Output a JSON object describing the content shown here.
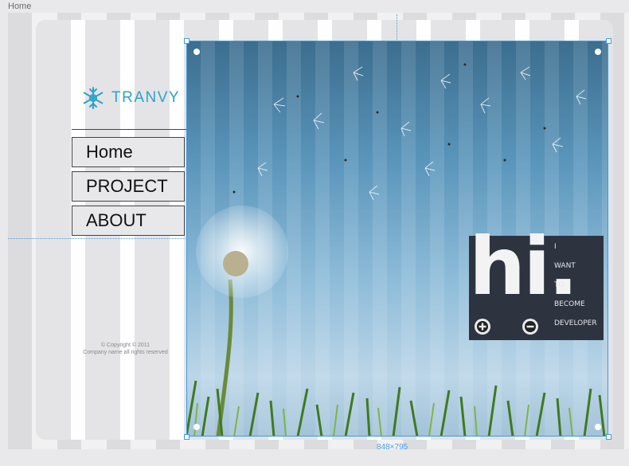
{
  "tab": {
    "label": "Home"
  },
  "brand": {
    "name": "TRANVY",
    "icon": "snowflake-logo-icon",
    "color": "#2aa4c9"
  },
  "nav": {
    "items": [
      {
        "label": "Home"
      },
      {
        "label": "PROJECT"
      },
      {
        "label": "ABOUT"
      }
    ]
  },
  "footer": {
    "copyright": "© Copyright © 2011",
    "rights": "Company name all rights reserved"
  },
  "hero": {
    "image": "dandelion-seeds-grass-image"
  },
  "hi_card": {
    "big": "hi.",
    "words": [
      "I",
      "WANT",
      "TO",
      "BECOME",
      "DEVELOPER"
    ],
    "zoom_in_icon": "plus-circle-icon",
    "zoom_out_icon": "minus-circle-icon"
  },
  "selection": {
    "size_label": "848×795"
  },
  "colors": {
    "accent": "#3d9be0",
    "card": "#2d3440"
  }
}
